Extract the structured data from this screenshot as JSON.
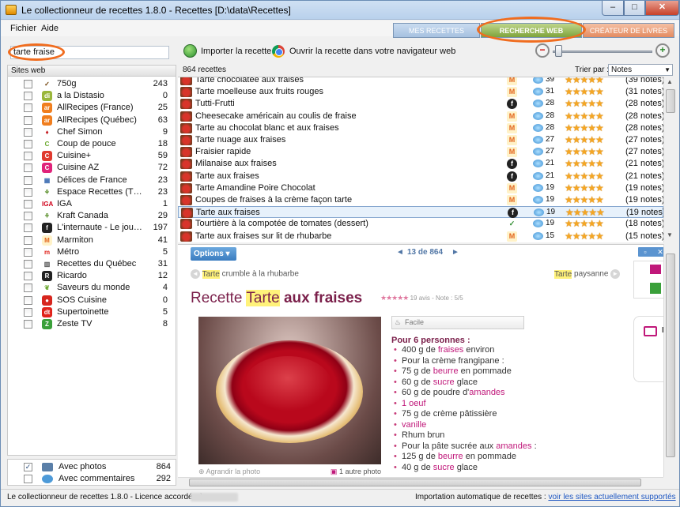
{
  "window": {
    "title": "Le collectionneur de recettes 1.8.0 - Recettes [D:\\data\\Recettes]",
    "buttons": {
      "minimize": "–",
      "maximize": "□",
      "close": "✕"
    }
  },
  "menu": {
    "file": "Fichier",
    "help": "Aide"
  },
  "tabs": {
    "my_recipes": "MES RECETTES",
    "web_search": "RECHERCHE WEB",
    "book_creator": "CRÉATEUR DE LIVRES"
  },
  "toolbar": {
    "search_value": "tarte fraise",
    "import_label": "Importer la recette",
    "open_browser_label": "Ouvrir la recette dans votre navigateur web",
    "zoom_level": 0.02
  },
  "sites_header": "Sites web",
  "sites": [
    {
      "name": "750g",
      "count": "243",
      "icon": "whisk-icon",
      "color": "#ffffff",
      "glyph": "✓",
      "fg": "#6b3b00"
    },
    {
      "name": "a la Distasio",
      "count": "0",
      "icon": "distasio-icon",
      "color": "#9ab63b",
      "glyph": "di",
      "fg": "#ffffff"
    },
    {
      "name": "AllRecipes (France)",
      "count": "25",
      "icon": "allrecipes-icon",
      "color": "#f07e1e",
      "glyph": "ar",
      "fg": "#ffffff"
    },
    {
      "name": "AllRecipes (Québec)",
      "count": "63",
      "icon": "allrecipes-icon",
      "color": "#f07e1e",
      "glyph": "ar",
      "fg": "#ffffff"
    },
    {
      "name": "Chef Simon",
      "count": "9",
      "icon": "chef-simon-icon",
      "color": "#ffffff",
      "glyph": "♦",
      "fg": "#c4161c"
    },
    {
      "name": "Coup de pouce",
      "count": "18",
      "icon": "coup-de-pouce-icon",
      "color": "#ffffff",
      "glyph": "C",
      "fg": "#6aa82e"
    },
    {
      "name": "Cuisine+",
      "count": "59",
      "icon": "cuisine-plus-icon",
      "color": "#e03a2f",
      "glyph": "C",
      "fg": "#ffffff"
    },
    {
      "name": "Cuisine AZ",
      "count": "72",
      "icon": "cuisine-az-icon",
      "color": "#e0237a",
      "glyph": "C",
      "fg": "#ffffff"
    },
    {
      "name": "Délices de France",
      "count": "23",
      "icon": "delices-icon",
      "color": "#ffffff",
      "glyph": "▦",
      "fg": "#3f6fb3"
    },
    {
      "name": "Espace Recettes (Ther...",
      "count": "23",
      "icon": "espace-recettes-icon",
      "color": "#ffffff",
      "glyph": "⚘",
      "fg": "#5a8f2a"
    },
    {
      "name": "IGA",
      "count": "1",
      "icon": "iga-icon",
      "color": "#ffffff",
      "glyph": "IGA",
      "fg": "#d0021b"
    },
    {
      "name": "Kraft Canada",
      "count": "29",
      "icon": "kraft-icon",
      "color": "#ffffff",
      "glyph": "⚘",
      "fg": "#5a8f2a"
    },
    {
      "name": "L'internaute - Le journ...",
      "count": "197",
      "icon": "internaute-icon",
      "color": "#222222",
      "glyph": "f",
      "fg": "#ffffff"
    },
    {
      "name": "Marmiton",
      "count": "41",
      "icon": "marmiton-icon",
      "color": "#fff2c8",
      "glyph": "M",
      "fg": "#e2641c"
    },
    {
      "name": "Métro",
      "count": "5",
      "icon": "metro-icon",
      "color": "#ffffff",
      "glyph": "m",
      "fg": "#e0231b"
    },
    {
      "name": "Recettes du Québec",
      "count": "31",
      "icon": "recettes-quebec-icon",
      "color": "#ffffff",
      "glyph": "▥",
      "fg": "#555555"
    },
    {
      "name": "Ricardo",
      "count": "12",
      "icon": "ricardo-icon",
      "color": "#222222",
      "glyph": "R",
      "fg": "#ffffff"
    },
    {
      "name": "Saveurs du monde",
      "count": "4",
      "icon": "saveurs-icon",
      "color": "#ffffff",
      "glyph": "❦",
      "fg": "#6aa82e"
    },
    {
      "name": "SOS Cuisine",
      "count": "0",
      "icon": "sos-cuisine-icon",
      "color": "#d7261e",
      "glyph": "●",
      "fg": "#ffffff"
    },
    {
      "name": "Supertoinette",
      "count": "5",
      "icon": "supertoinette-icon",
      "color": "#e0231b",
      "glyph": "dt",
      "fg": "#ffffff"
    },
    {
      "name": "Zeste TV",
      "count": "8",
      "icon": "zeste-icon",
      "color": "#3aa03a",
      "glyph": "Z",
      "fg": "#ffffff"
    }
  ],
  "filters": [
    {
      "name": "Avec photos",
      "count": "864",
      "checked": "✓"
    },
    {
      "name": "Avec commentaires",
      "count": "292",
      "checked": ""
    }
  ],
  "results": {
    "count": "864 recettes",
    "sort_label": "Trier par :",
    "sort_value": "Notes",
    "rows": [
      {
        "name": "Tarte chocolatée aux fraises",
        "src": "M",
        "cls": "m",
        "comments": "39",
        "stars": "★★★★★",
        "notes": "(39 notes)"
      },
      {
        "name": "Tarte moelleuse aux fruits rouges",
        "src": "M",
        "cls": "m",
        "comments": "31",
        "stars": "★★★★★",
        "notes": "(31 notes)"
      },
      {
        "name": "Tutti-Frutti",
        "src": "f",
        "cls": "f",
        "comments": "28",
        "stars": "★★★★★",
        "notes": "(28 notes)"
      },
      {
        "name": "Cheesecake américain au coulis de fraise",
        "src": "M",
        "cls": "m",
        "comments": "28",
        "stars": "★★★★★",
        "notes": "(28 notes)"
      },
      {
        "name": "Tarte au chocolat blanc et aux fraises",
        "src": "M",
        "cls": "m",
        "comments": "28",
        "stars": "★★★★★",
        "notes": "(28 notes)"
      },
      {
        "name": "Tarte nuage aux fraises",
        "src": "M",
        "cls": "m",
        "comments": "27",
        "stars": "★★★★★",
        "notes": "(27 notes)"
      },
      {
        "name": "Fraisier rapide",
        "src": "M",
        "cls": "m",
        "comments": "27",
        "stars": "★★★★★",
        "notes": "(27 notes)"
      },
      {
        "name": "Milanaise aux fraises",
        "src": "f",
        "cls": "f",
        "comments": "21",
        "stars": "★★★★★",
        "notes": "(21 notes)"
      },
      {
        "name": "Tarte aux fraises",
        "src": "f",
        "cls": "f",
        "comments": "21",
        "stars": "★★★★★",
        "notes": "(21 notes)"
      },
      {
        "name": "Tarte Amandine Poire Chocolat",
        "src": "M",
        "cls": "m",
        "comments": "19",
        "stars": "★★★★★",
        "notes": "(19 notes)"
      },
      {
        "name": "Coupes de fraises à la crème façon tarte",
        "src": "M",
        "cls": "m",
        "comments": "19",
        "stars": "★★★★★",
        "notes": "(19 notes)"
      },
      {
        "name": "Tarte aux fraises",
        "src": "f",
        "cls": "f",
        "comments": "19",
        "stars": "★★★★★",
        "notes": "(19 notes)"
      },
      {
        "name": "Tourtière à la compotée de tomates (dessert)",
        "src": "✓",
        "cls": "v",
        "comments": "19",
        "stars": "★★★★★",
        "notes": "(18 notes)"
      },
      {
        "name": "Tarte aux fraises sur lit de rhubarbe",
        "src": "M",
        "cls": "m",
        "comments": "15",
        "stars": "★★★★★",
        "notes": "(15 notes)"
      }
    ]
  },
  "detail": {
    "options": "Options ▾",
    "page_info": "13 de 864",
    "prev_arrow": "◄",
    "next_arrow": "►",
    "prev_word": "Tarte",
    "prev_rest": " crumble à la rhubarbe",
    "next_word": "Tarte",
    "next_rest": " paysanne",
    "title_pre": "Recette ",
    "title_hl": "Tarte",
    "title_post": " aux fraises",
    "meta_stars": "★★★★★",
    "meta_text": " 19 avis - Note : 5/5",
    "difficulty": "Facile",
    "photo_caption": "Agrandir la photo",
    "photo_count": "1 autre photo",
    "side_label": "N",
    "ingredients_header": "Pour 6 personnes :",
    "ingredients": [
      {
        "pre": "400 g de ",
        "hi": "fraises",
        "post": " environ"
      },
      {
        "pre": "Pour la crème frangipane :",
        "hi": "",
        "post": ""
      },
      {
        "pre": "75 g de ",
        "hi": "beurre",
        "post": " en pommade"
      },
      {
        "pre": "60 g de ",
        "hi": "sucre",
        "post": " glace"
      },
      {
        "pre": "60 g de poudre d'",
        "hi": "amandes",
        "post": ""
      },
      {
        "pre": "",
        "hi": "1 oeuf",
        "post": ""
      },
      {
        "pre": "75 g de crème pâtissière",
        "hi": "",
        "post": ""
      },
      {
        "pre": "",
        "hi": "vanille",
        "post": ""
      },
      {
        "pre": "Rhum brun",
        "hi": "",
        "post": ""
      },
      {
        "pre": "Pour la pâte sucrée aux ",
        "hi": "amandes",
        "post": " :"
      },
      {
        "pre": "125 g de ",
        "hi": "beurre",
        "post": " en pommade"
      },
      {
        "pre": "40 g de ",
        "hi": "sucre",
        "post": " glace"
      }
    ]
  },
  "status": {
    "left": "Le collectionneur de recettes 1.8.0 - Licence accordée à",
    "right_text": "Importation automatique de recettes : ",
    "right_link": "voir les sites actuellement supportés"
  }
}
